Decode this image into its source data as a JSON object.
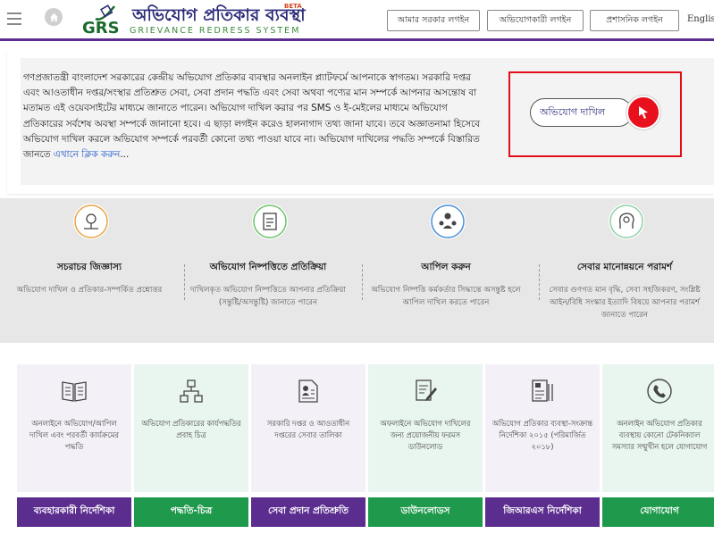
{
  "header": {
    "logo_grs": "GRS",
    "logo_title": "অভিযোগ প্রতিকার ব্যবস্থা",
    "logo_subtitle": "GRIEVANCE REDRESS SYSTEM",
    "logo_beta": "BETA",
    "login_buttons": [
      "আমার সরকার লগইন",
      "অভিযোগকারী লগইন",
      "প্রশাসনিক লগইন"
    ],
    "language": "English"
  },
  "welcome": {
    "text": "গণপ্রজাতন্ত্রী বাংলাদেশ সরকারের কেন্দ্রীয় অভিযোগ প্রতিকার ব্যবস্থার অনলাইন প্ল্যাটফর্মে আপনাকে স্বাগতম। সরকারি দপ্তর এবং আওতাধীন দপ্তর/সংস্থার প্রতিশ্রুত সেবা, সেবা প্রদান পদ্ধতি এবং সেবা অথবা পণ্যের মান সম্পর্কে আপনার অসন্তোষ বা মতামত এই ওয়েবসাইটের মাধ্যমে জানাতে পারেন। অভিযোগ দাখিল করার পর SMS ও ই-মেইলের মাধ্যমে অভিযোগ প্রতিকারের সর্বশেষ অবস্থা সম্পর্কে জানানো হবে। এ ছাড়া লগইন করেও হালনাগাদ তথ্য জানা যাবে। তবে অজ্ঞাতনামা হিসেবে অভিযোগ দাখিল করলে অভিযোগ সম্পর্কে পরবর্তী কোনো তথ্য পাওয়া যাবে না। অভিযোগ দাখিলের পদ্ধতি সম্পর্কে বিস্তারিত জানতে ",
    "link_text": "এখানে ক্লিক করুন",
    "link_suffix": "...",
    "submit_label": "অভিযোগ দাখিল"
  },
  "services": [
    {
      "icon": "map-pin-icon",
      "title": "সচরাচর জিজ্ঞাস্য",
      "desc": "অভিযোগ দাখিল ও প্রতিকার-সম্পর্কিত প্রশ্নোত্তর"
    },
    {
      "icon": "clipboard-icon",
      "title": "অভিযোগ নিষ্পত্তিতে প্রতিক্রিয়া",
      "desc": "দাখিলকৃত অভিযোগ নিষ্পত্তিতে আপনার প্রতিক্রিয়া (সন্তুষ্টি/অসন্তুষ্টি) জানাতে পারেন"
    },
    {
      "icon": "appeal-people-icon",
      "title": "আপিল করুন",
      "desc": "অভিযোগ নিষ্পত্তি কর্মকর্তার সিদ্ধান্তে অসন্তুষ্ট হলে আপিল দাখিল করতে পারেন"
    },
    {
      "icon": "lightbulb-head-icon",
      "title": "সেবার মানোন্নয়নে পরামর্শ",
      "desc": "সেবার গুণগত মান বৃদ্ধি, সেবা সহজিকরণ, সংশ্লিষ্ট আইন/বিধি সংস্কার ইত্যাদি বিষয়ে আপনার পরামর্শ জানাতে পারেন"
    }
  ],
  "cards": [
    {
      "icon": "book-icon",
      "desc": "অনলাইনে অভিযোগ/আপিল দাখিল এবং পরবর্তী কার্যক্রমের পদ্ধতি",
      "button": "ব্যবহারকারী নির্দেশিকা",
      "bg": "#f4f0f7",
      "color": "#5b2d8f"
    },
    {
      "icon": "flowchart-icon",
      "desc": "অভিযোগ প্রতিকারের কার্যপদ্ধতির প্রবাহ চিত্র",
      "button": "পদ্ধতি-চিত্র",
      "bg": "#e9f5ef",
      "color": "#1f9a4c"
    },
    {
      "icon": "document-user-icon",
      "desc": "সরকারি দপ্তর ও আওতাধীন দপ্তরের সেবার তালিকা",
      "button": "সেবা প্রদান প্রতিশ্রুতি",
      "bg": "#f4f0f7",
      "color": "#5b2d8f"
    },
    {
      "icon": "form-edit-icon",
      "desc": "অফলাইনে অভিযোগ দাখিলের জন্য প্রয়োজনীয় ফরমস ডাউনলোড",
      "button": "ডাউনলোডস",
      "bg": "#e9f5ef",
      "color": "#1f9a4c"
    },
    {
      "icon": "guideline-document-icon",
      "desc": "অভিযোগ প্রতিকার ব্যবস্থা-সংক্রান্ত নির্দেশিকা ২০১৫ (পরিমার্জিত ২০১৮)",
      "button": "জিআরএস নির্দেশিকা",
      "bg": "#f4f0f7",
      "color": "#5b2d8f"
    },
    {
      "icon": "phone-icon",
      "desc": "অনলাইন অভিযোগ প্রতিকার ব্যবস্থায় কোনো টেকনিক্যাল সমস্যার সম্মুখীন হলে যোগাযোগ",
      "button": "যোগাযোগ",
      "bg": "#e9f5ef",
      "color": "#1f9a4c"
    }
  ]
}
